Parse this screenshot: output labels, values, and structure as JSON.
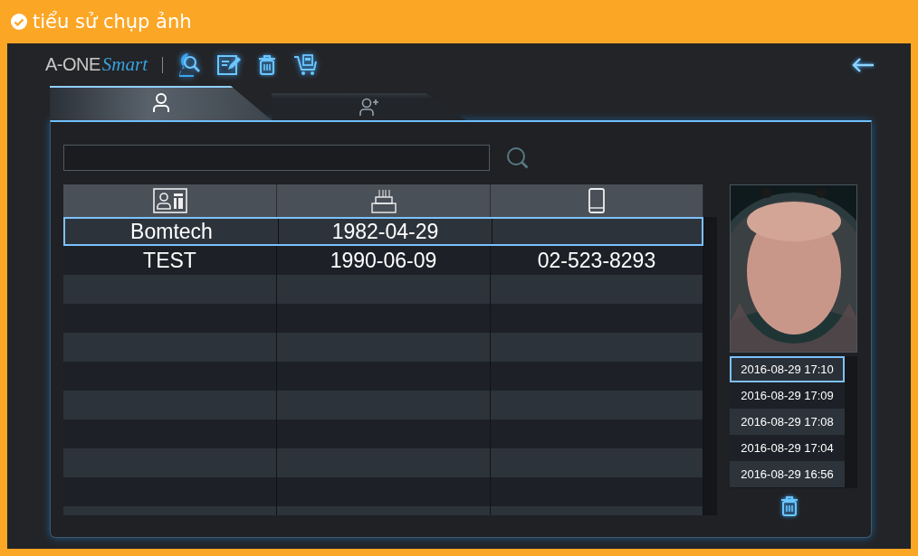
{
  "header": {
    "title": "tiểu sử chụp ảnh"
  },
  "logo": {
    "brand": "A-ONE",
    "suffix": "Smart"
  },
  "tabs": [
    {
      "kind": "person",
      "selected": true
    },
    {
      "kind": "add",
      "selected": false
    }
  ],
  "table": {
    "rows": [
      {
        "cells": [
          "Bomtech",
          "1982-04-29",
          ""
        ],
        "selected": true
      },
      {
        "cells": [
          "TEST",
          "1990-06-09",
          "02-523-8293"
        ],
        "selected": false
      }
    ]
  },
  "captures": [
    {
      "time": "2016-08-29 17:10",
      "selected": true
    },
    {
      "time": "2016-08-29 17:09",
      "selected": false
    },
    {
      "time": "2016-08-29 17:08",
      "selected": false
    },
    {
      "time": "2016-08-29 17:04",
      "selected": false
    },
    {
      "time": "2016-08-29 16:56",
      "selected": false
    }
  ]
}
